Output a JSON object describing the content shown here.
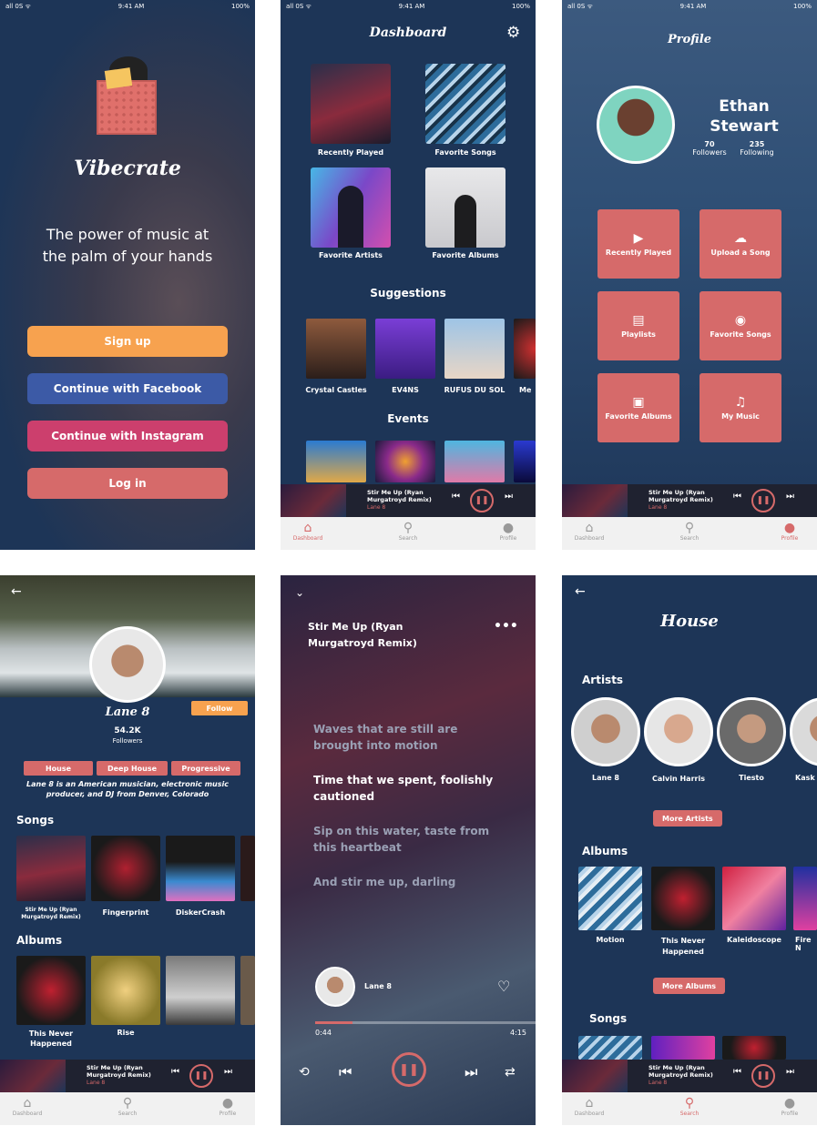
{
  "status": {
    "carrier": "all 0S ᯤ",
    "time": "9:41 AM",
    "battery": "100%"
  },
  "welcome": {
    "logo_text": "Vibecrate",
    "tagline": "The power of music at the palm of your hands",
    "buttons": [
      "Sign up",
      "Continue with Facebook",
      "Continue with Instagram",
      "Log in"
    ],
    "colors": {
      "signup": "#f7a24f",
      "facebook": "#3c5aa6",
      "instagram": "#cc3f6d",
      "login": "#d66a6a"
    }
  },
  "dashboard": {
    "title": "Dashboard",
    "tiles": [
      "Recently Played",
      "Favorite Songs",
      "Favorite Artists",
      "Favorite Albums"
    ],
    "suggestions_title": "Suggestions",
    "suggestions": [
      "Crystal Castles",
      "EV4NS",
      "RUFUS DU SOL",
      "Me"
    ],
    "events_title": "Events"
  },
  "mini_player": {
    "title": "Stir Me Up (Ryan Murgatroyd Remix)",
    "artist": "Lane 8"
  },
  "tabs": [
    "Dashboard",
    "Search",
    "Profile"
  ],
  "profile": {
    "title": "Profile",
    "name_first": "Ethan",
    "name_last": "Stewart",
    "followers_count": "70",
    "followers_label": "Followers",
    "following_count": "235",
    "following_label": "Following",
    "menu": [
      "Recently Played",
      "Upload a Song",
      "Playlists",
      "Favorite Songs",
      "Favorite Albums",
      "My Music"
    ]
  },
  "artist": {
    "name": "Lane 8",
    "follow": "Follow",
    "followers_count": "54.2K",
    "followers_label": "Followers",
    "genres": [
      "House",
      "Deep House",
      "Progressive"
    ],
    "bio": "Lane 8 is an American musician, electronic music producer, and DJ from Denver, Colorado",
    "songs_title": "Songs",
    "songs": [
      "Stir Me Up (Ryan Murgatroyd Remix)",
      "Fingerprint",
      "DiskerCrash"
    ],
    "albums_title": "Albums",
    "albums": [
      "This Never Happened",
      "Rise"
    ]
  },
  "now_playing": {
    "title": "Stir Me Up (Ryan Murgatroyd Remix)",
    "lyrics": [
      "Waves that are still are brought into motion",
      "Time that we spent, foolishly cautioned",
      "Sip on this water, taste from this heartbeat",
      "And stir me up, darling"
    ],
    "artist": "Lane 8",
    "elapsed": "0:44",
    "duration": "4:15",
    "progress": 0.17
  },
  "genre": {
    "title": "House",
    "artists_title": "Artists",
    "artists": [
      "Lane 8",
      "Calvin Harris",
      "Tiesto",
      "Kask"
    ],
    "more_artists": "More Artists",
    "albums_title": "Albums",
    "albums": [
      "Motion",
      "This Never Happened",
      "Kaleidoscope",
      "Fire N"
    ],
    "more_albums": "More Albums",
    "songs_title": "Songs"
  }
}
